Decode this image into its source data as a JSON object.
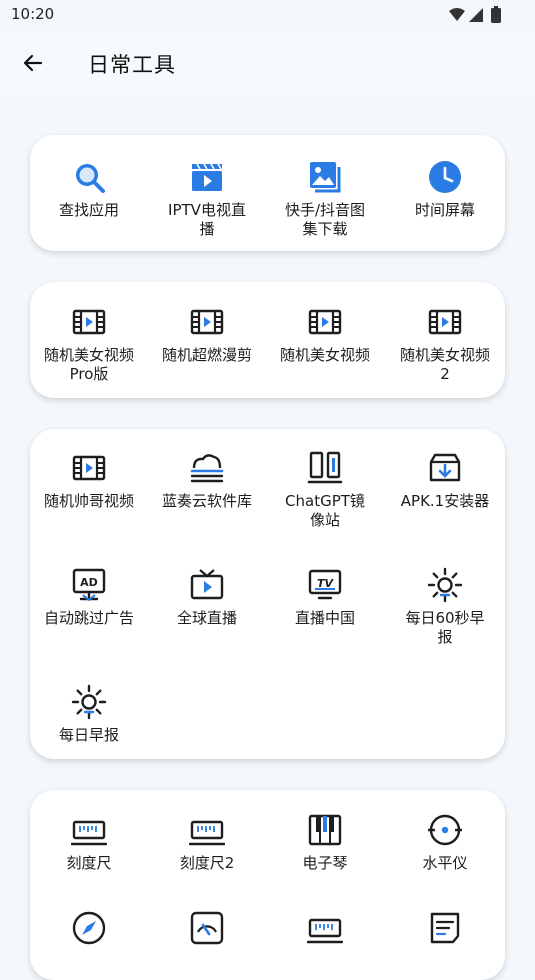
{
  "status": {
    "time": "10:20"
  },
  "header": {
    "title": "日常工具"
  },
  "cards": [
    {
      "items": [
        {
          "label": "查找应用",
          "icon": "search-icon"
        },
        {
          "label": "IPTV电视直播",
          "icon": "clapperboard-icon"
        },
        {
          "label": "快手/抖音图集下载",
          "icon": "image-gallery-icon"
        },
        {
          "label": "时间屏幕",
          "icon": "clock-icon"
        }
      ]
    },
    {
      "items": [
        {
          "label": "随机美女视频Pro版",
          "icon": "film-icon"
        },
        {
          "label": "随机超燃漫剪",
          "icon": "film-icon"
        },
        {
          "label": "随机美女视频",
          "icon": "film-icon"
        },
        {
          "label": "随机美女视频2",
          "icon": "film-icon"
        }
      ]
    },
    {
      "items": [
        {
          "label": "随机帅哥视频",
          "icon": "film-icon"
        },
        {
          "label": "蓝奏云软件库",
          "icon": "cloud-icon"
        },
        {
          "label": "ChatGPT镜像站",
          "icon": "mirror-icon"
        },
        {
          "label": "APK.1安装器",
          "icon": "package-install-icon"
        },
        {
          "label": "自动跳过广告",
          "icon": "ad-skip-icon"
        },
        {
          "label": "全球直播",
          "icon": "tv-play-icon"
        },
        {
          "label": "直播中国",
          "icon": "tv-monitor-icon"
        },
        {
          "label": "每日60秒早报",
          "icon": "sun-icon"
        },
        {
          "label": "每日早报",
          "icon": "sun-icon"
        }
      ]
    },
    {
      "items": [
        {
          "label": "刻度尺",
          "icon": "ruler-icon"
        },
        {
          "label": "刻度尺2",
          "icon": "ruler-icon"
        },
        {
          "label": "电子琴",
          "icon": "piano-icon"
        },
        {
          "label": "水平仪",
          "icon": "level-icon"
        },
        {
          "label": "",
          "icon": "compass-icon"
        },
        {
          "label": "",
          "icon": "gauge-icon"
        },
        {
          "label": "",
          "icon": "ruler-icon"
        },
        {
          "label": "",
          "icon": "note-icon"
        }
      ]
    }
  ],
  "colors": {
    "accent": "#2a7be4",
    "icon_dark": "#1e1e1e",
    "background": "#f3f8fc"
  }
}
